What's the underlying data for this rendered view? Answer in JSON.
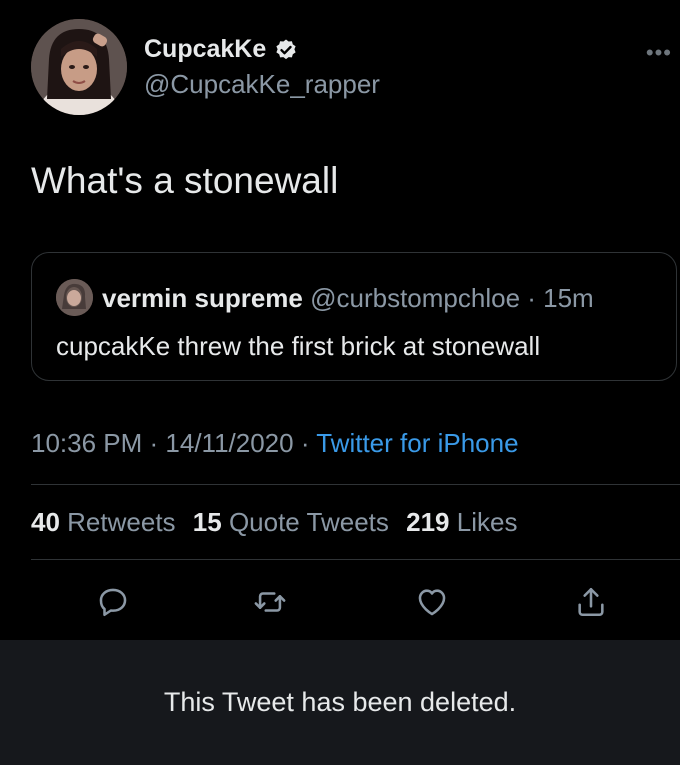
{
  "tweet": {
    "author_name": "CupcakKe",
    "author_handle": "@CupcakKe_rapper",
    "more_label": "•••",
    "text": "What's a stonewall",
    "timestamp": "10:36 PM · 14/11/2020 · ",
    "source": "Twitter for iPhone"
  },
  "quote": {
    "name": "vermin supreme",
    "meta": " @curbstompchloe · 15m",
    "text": "cupcakKe threw the first brick at stonewall"
  },
  "stats": {
    "retweets_count": "40",
    "retweets_label": "Retweets",
    "quotes_count": "15",
    "quotes_label": "Quote Tweets",
    "likes_count": "219",
    "likes_label": "Likes"
  },
  "actions": {
    "icons": [
      "reply-icon",
      "retweet-icon",
      "like-icon",
      "share-icon"
    ]
  },
  "banner": {
    "text": "This Tweet has been deleted."
  },
  "colors": {
    "background": "#000000",
    "text": "#e7e9ea",
    "secondary": "#8b98a5",
    "link": "#3a9ae8",
    "border": "#2f3336",
    "banner_bg": "#16181c"
  }
}
